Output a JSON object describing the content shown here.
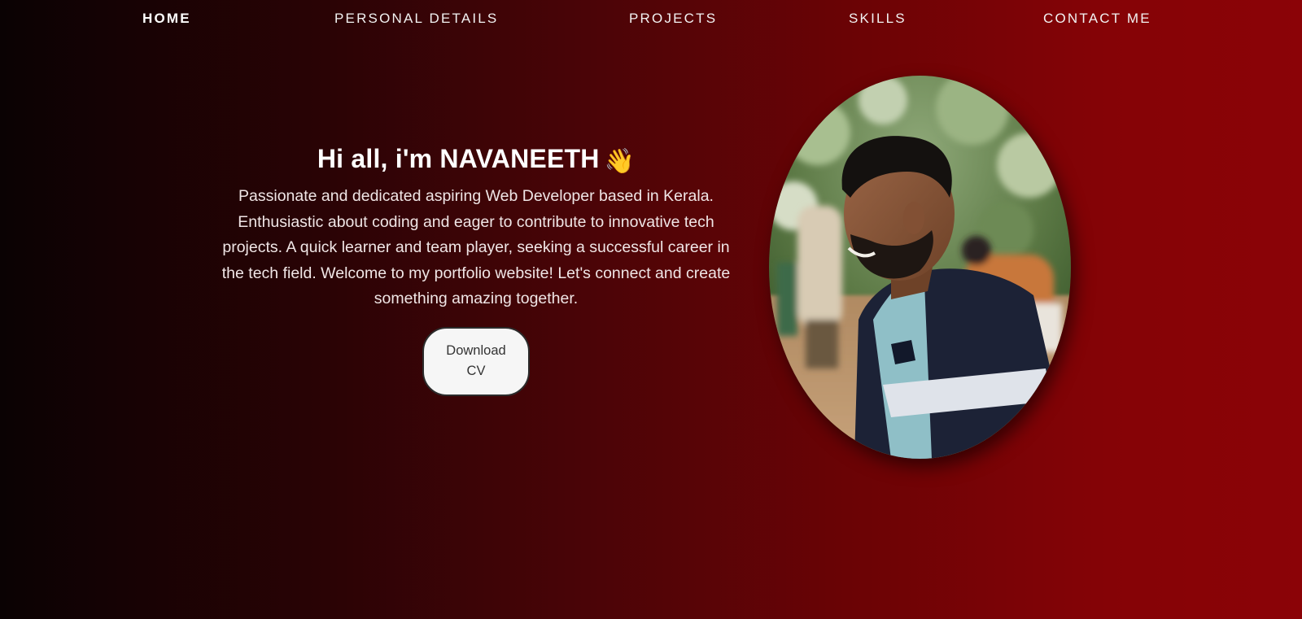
{
  "nav": {
    "items": [
      {
        "label": "HOME",
        "active": true
      },
      {
        "label": "PERSONAL DETAILS",
        "active": false
      },
      {
        "label": "PROJECTS",
        "active": false
      },
      {
        "label": "SKILLS",
        "active": false
      },
      {
        "label": "CONTACT ME",
        "active": false
      }
    ]
  },
  "hero": {
    "title": "Hi all, i'm NAVANEETH",
    "wave_emoji": "👋",
    "description": "Passionate and dedicated aspiring Web Developer based in Kerala. Enthusiastic about coding and eager to contribute to innovative tech projects. A quick learner and team player, seeking a successful career in the tech field. Welcome to my portfolio website! Let's connect and create something amazing together.",
    "button_label": "Download CV"
  },
  "profile_photo": {
    "icon": "profile-photo"
  },
  "colors": {
    "background_start": "#0a0203",
    "background_end": "#8b0307",
    "text": "#ffffff",
    "button_bg": "#f6f6f6"
  }
}
